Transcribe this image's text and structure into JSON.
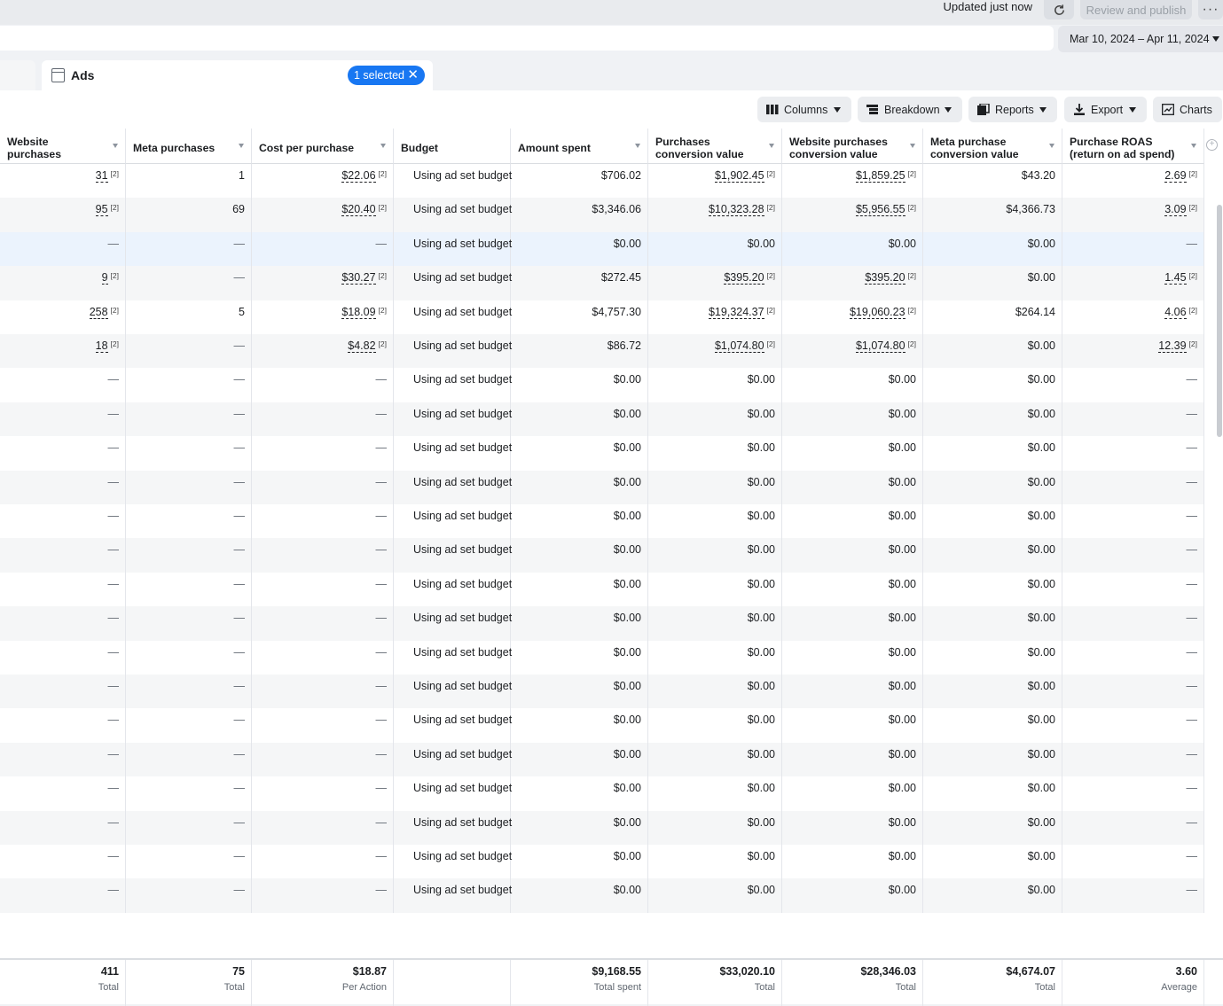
{
  "topbar": {
    "updated": "Updated just now",
    "publish": "Review and publish",
    "more": "···"
  },
  "date_range": "Mar 10, 2024 – Apr 11, 2024",
  "tab": {
    "label": "Ads",
    "selected": "1 selected"
  },
  "toolbar": {
    "columns": "Columns",
    "breakdown": "Breakdown",
    "reports": "Reports",
    "export": "Export",
    "charts": "Charts"
  },
  "headers": [
    "Website purchases",
    "Meta purchases",
    "Cost per purchase",
    "Budget",
    "Amount spent",
    "Purchases conversion value",
    "Website purchases conversion value",
    "Meta purchase conversion value",
    "Purchase ROAS (return on ad spend)"
  ],
  "rows": [
    [
      "31",
      "1",
      "$22.06",
      "Using ad set budget",
      "$706.02",
      "$1,902.45",
      "$1,859.25",
      "$43.20",
      "2.69"
    ],
    [
      "95",
      "69",
      "$20.40",
      "Using ad set budget",
      "$3,346.06",
      "$10,323.28",
      "$5,956.55",
      "$4,366.73",
      "3.09"
    ],
    [
      "—",
      "—",
      "—",
      "Using ad set budget",
      "$0.00",
      "$0.00",
      "$0.00",
      "$0.00",
      "—"
    ],
    [
      "9",
      "—",
      "$30.27",
      "Using ad set budget",
      "$272.45",
      "$395.20",
      "$395.20",
      "$0.00",
      "1.45"
    ],
    [
      "258",
      "5",
      "$18.09",
      "Using ad set budget",
      "$4,757.30",
      "$19,324.37",
      "$19,060.23",
      "$264.14",
      "4.06"
    ],
    [
      "18",
      "—",
      "$4.82",
      "Using ad set budget",
      "$86.72",
      "$1,074.80",
      "$1,074.80",
      "$0.00",
      "12.39"
    ],
    [
      "—",
      "—",
      "—",
      "Using ad set budget",
      "$0.00",
      "$0.00",
      "$0.00",
      "$0.00",
      "—"
    ],
    [
      "—",
      "—",
      "—",
      "Using ad set budget",
      "$0.00",
      "$0.00",
      "$0.00",
      "$0.00",
      "—"
    ],
    [
      "—",
      "—",
      "—",
      "Using ad set budget",
      "$0.00",
      "$0.00",
      "$0.00",
      "$0.00",
      "—"
    ],
    [
      "—",
      "—",
      "—",
      "Using ad set budget",
      "$0.00",
      "$0.00",
      "$0.00",
      "$0.00",
      "—"
    ],
    [
      "—",
      "—",
      "—",
      "Using ad set budget",
      "$0.00",
      "$0.00",
      "$0.00",
      "$0.00",
      "—"
    ],
    [
      "—",
      "—",
      "—",
      "Using ad set budget",
      "$0.00",
      "$0.00",
      "$0.00",
      "$0.00",
      "—"
    ],
    [
      "—",
      "—",
      "—",
      "Using ad set budget",
      "$0.00",
      "$0.00",
      "$0.00",
      "$0.00",
      "—"
    ],
    [
      "—",
      "—",
      "—",
      "Using ad set budget",
      "$0.00",
      "$0.00",
      "$0.00",
      "$0.00",
      "—"
    ],
    [
      "—",
      "—",
      "—",
      "Using ad set budget",
      "$0.00",
      "$0.00",
      "$0.00",
      "$0.00",
      "—"
    ],
    [
      "—",
      "—",
      "—",
      "Using ad set budget",
      "$0.00",
      "$0.00",
      "$0.00",
      "$0.00",
      "—"
    ],
    [
      "—",
      "—",
      "—",
      "Using ad set budget",
      "$0.00",
      "$0.00",
      "$0.00",
      "$0.00",
      "—"
    ],
    [
      "—",
      "—",
      "—",
      "Using ad set budget",
      "$0.00",
      "$0.00",
      "$0.00",
      "$0.00",
      "—"
    ],
    [
      "—",
      "—",
      "—",
      "Using ad set budget",
      "$0.00",
      "$0.00",
      "$0.00",
      "$0.00",
      "—"
    ],
    [
      "—",
      "—",
      "—",
      "Using ad set budget",
      "$0.00",
      "$0.00",
      "$0.00",
      "$0.00",
      "—"
    ],
    [
      "—",
      "—",
      "—",
      "Using ad set budget",
      "$0.00",
      "$0.00",
      "$0.00",
      "$0.00",
      "—"
    ],
    [
      "—",
      "—",
      "—",
      "Using ad set budget",
      "$0.00",
      "$0.00",
      "$0.00",
      "$0.00",
      "—"
    ]
  ],
  "footnote_mark": "[2]",
  "totals": [
    {
      "value": "411",
      "label": "Total"
    },
    {
      "value": "75",
      "label": "Total"
    },
    {
      "value": "$18.87",
      "label": "Per Action"
    },
    {
      "value": "",
      "label": ""
    },
    {
      "value": "$9,168.55",
      "label": "Total spent"
    },
    {
      "value": "$33,020.10",
      "label": "Total"
    },
    {
      "value": "$28,346.03",
      "label": "Total"
    },
    {
      "value": "$4,674.07",
      "label": "Total"
    },
    {
      "value": "3.60",
      "label": "Average"
    }
  ]
}
